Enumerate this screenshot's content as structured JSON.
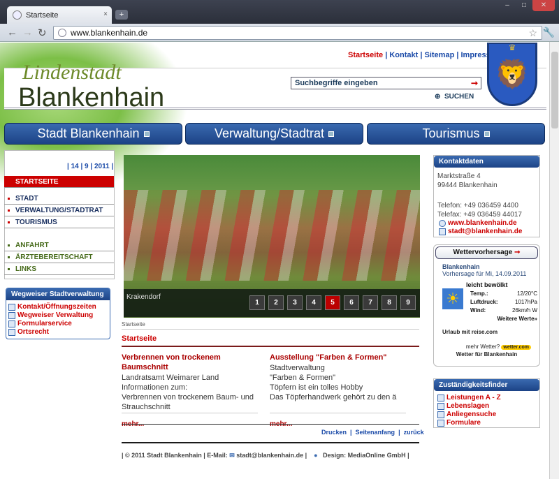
{
  "browser": {
    "tab_title": "Startseite",
    "new_tab": "+",
    "close_tab": "×",
    "address": "www.blankenhain.de",
    "win_min": "–",
    "win_max": "□",
    "win_close": "✕"
  },
  "header": {
    "nav": [
      "Startseite",
      "Kontakt",
      "Sitemap",
      "Impressum"
    ],
    "logo_top": "Lindenstadt",
    "logo_main": "Blankenhain",
    "search_placeholder": "Suchbegriffe eingeben",
    "search_label": "SUCHEN"
  },
  "main_nav": [
    "Stadt Blankenhain",
    "Verwaltung/Stadtrat",
    "Tourismus"
  ],
  "left": {
    "date": "| 14 | 9 | 2011 |",
    "nav": [
      "STARTSEITE",
      "STADT",
      "VERWALTUNG/STADTRAT",
      "TOURISMUS"
    ],
    "nav2": [
      "ANFAHRT",
      "ÄRZTEBEREITSCHAFT",
      "LINKS"
    ],
    "wegweiser_title": "Wegweiser Stadtverwaltung",
    "wegweiser_links": [
      "Kontakt/Öffnungszeiten",
      "Wegweiser Verwaltung",
      "Formularservice",
      "Ortsrecht"
    ]
  },
  "slider": {
    "caption": "Krakendorf",
    "pages": [
      "1",
      "2",
      "3",
      "4",
      "5",
      "6",
      "7",
      "8",
      "9"
    ],
    "active": "5"
  },
  "content": {
    "breadcrumb": "Startseite",
    "title": "Startseite",
    "articles": [
      {
        "title": "Verbrennen von trockenem Baumschnitt",
        "lines": [
          "Landratsamt Weimarer Land",
          "Informationen zum:",
          "Verbrennen von trockenem Baum- und Strauchschnitt"
        ],
        "more": "mehr..."
      },
      {
        "title": "Ausstellung \"Farben & Formen\"",
        "lines": [
          "Stadtverwaltung",
          "\"Farben & Formen\"",
          "Töpfern ist ein tolles Hobby",
          "Das Töpferhandwerk gehört zu den ä"
        ],
        "more": "mehr..."
      }
    ],
    "tools": [
      "Drucken",
      "Seitenanfang",
      "zurück"
    ],
    "footer_left": "| © 2011 Stadt Blankenhain | E-Mail:",
    "footer_email": "stadt@blankenhain.de |",
    "footer_design": "Design: MediaOnline GmbH |"
  },
  "right": {
    "kontakt_title": "Kontaktdaten",
    "address1": "Marktstraße 4",
    "address2": "99444 Blankenhain",
    "phone": "Telefon: +49 036459 4400",
    "fax": "Telefax:  +49 036459 44017",
    "web": "www.blankenhain.de",
    "email": "stadt@blankenhain.de",
    "wetter_title": "Wettervorhersage",
    "wetter_city": "Blankenhain",
    "wetter_date": "Vorhersage für Mi, 14.09.2011",
    "wetter_desc": "leicht bewölkt",
    "temp_label": "Temp.:",
    "temp": "12/20°C",
    "druck_label": "Luftdruck:",
    "druck": "1017hPa",
    "wind_label": "Wind:",
    "wind": "26km/h W",
    "more": "Weitere Werte»",
    "urlaub": "Urlaub mit reise.com",
    "mehr_wetter": "mehr Wetter?",
    "wetter_com": "wetter.com",
    "wetter_link": "Wetter für Blankenhain",
    "zust_title": "Zuständigkeitsfinder",
    "zust_links": [
      "Leistungen A - Z",
      "Lebenslagen",
      "Anliegensuche",
      "Formulare"
    ]
  }
}
